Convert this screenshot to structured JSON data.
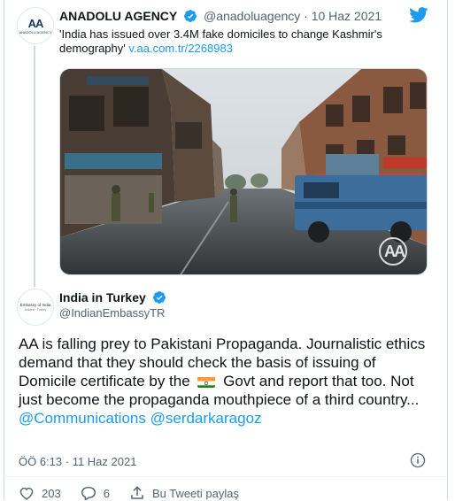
{
  "quoted_tweet": {
    "name": "ANADOLU AGENCY",
    "handle": "@anadoluagency",
    "separator": "·",
    "date": "10 Haz 2021",
    "text": "'India has issued over 3.4M fake domiciles to change Kashmir's demography'",
    "link": "v.aa.com.tr/2268983",
    "avatar_text": "AA",
    "avatar_subtext": "ANADOLU AGENCY",
    "watermark": "AA"
  },
  "reply_tweet": {
    "name": "India in Turkey",
    "handle": "@IndianEmbassyTR",
    "avatar_line1": "Embassy of India",
    "avatar_line2": "Ankara · Turkey",
    "body_part1": "AA is falling prey to Pakistani Propaganda. Journalistic ethics demand that they should check the basis of issuing of Domicile certificate by the",
    "body_part2": "Govt and report that too. Not just become the propaganda mouthpiece of a third country...",
    "mention1": "@Communications",
    "mention2": "@serdarkaragoz",
    "timestamp": "ÖÖ 6:13 · 11 Haz 2021"
  },
  "actions": {
    "likes": "203",
    "replies": "6",
    "share_label": "Bu Tweeti paylaş"
  },
  "colors": {
    "accent": "#1d9bf0",
    "secondary_text": "#536471",
    "verified": "#1d9bf0"
  },
  "icons": [
    "twitter-bird-icon",
    "verified-badge-icon",
    "info-icon",
    "heart-icon",
    "reply-icon",
    "share-icon",
    "india-flag-icon"
  ]
}
